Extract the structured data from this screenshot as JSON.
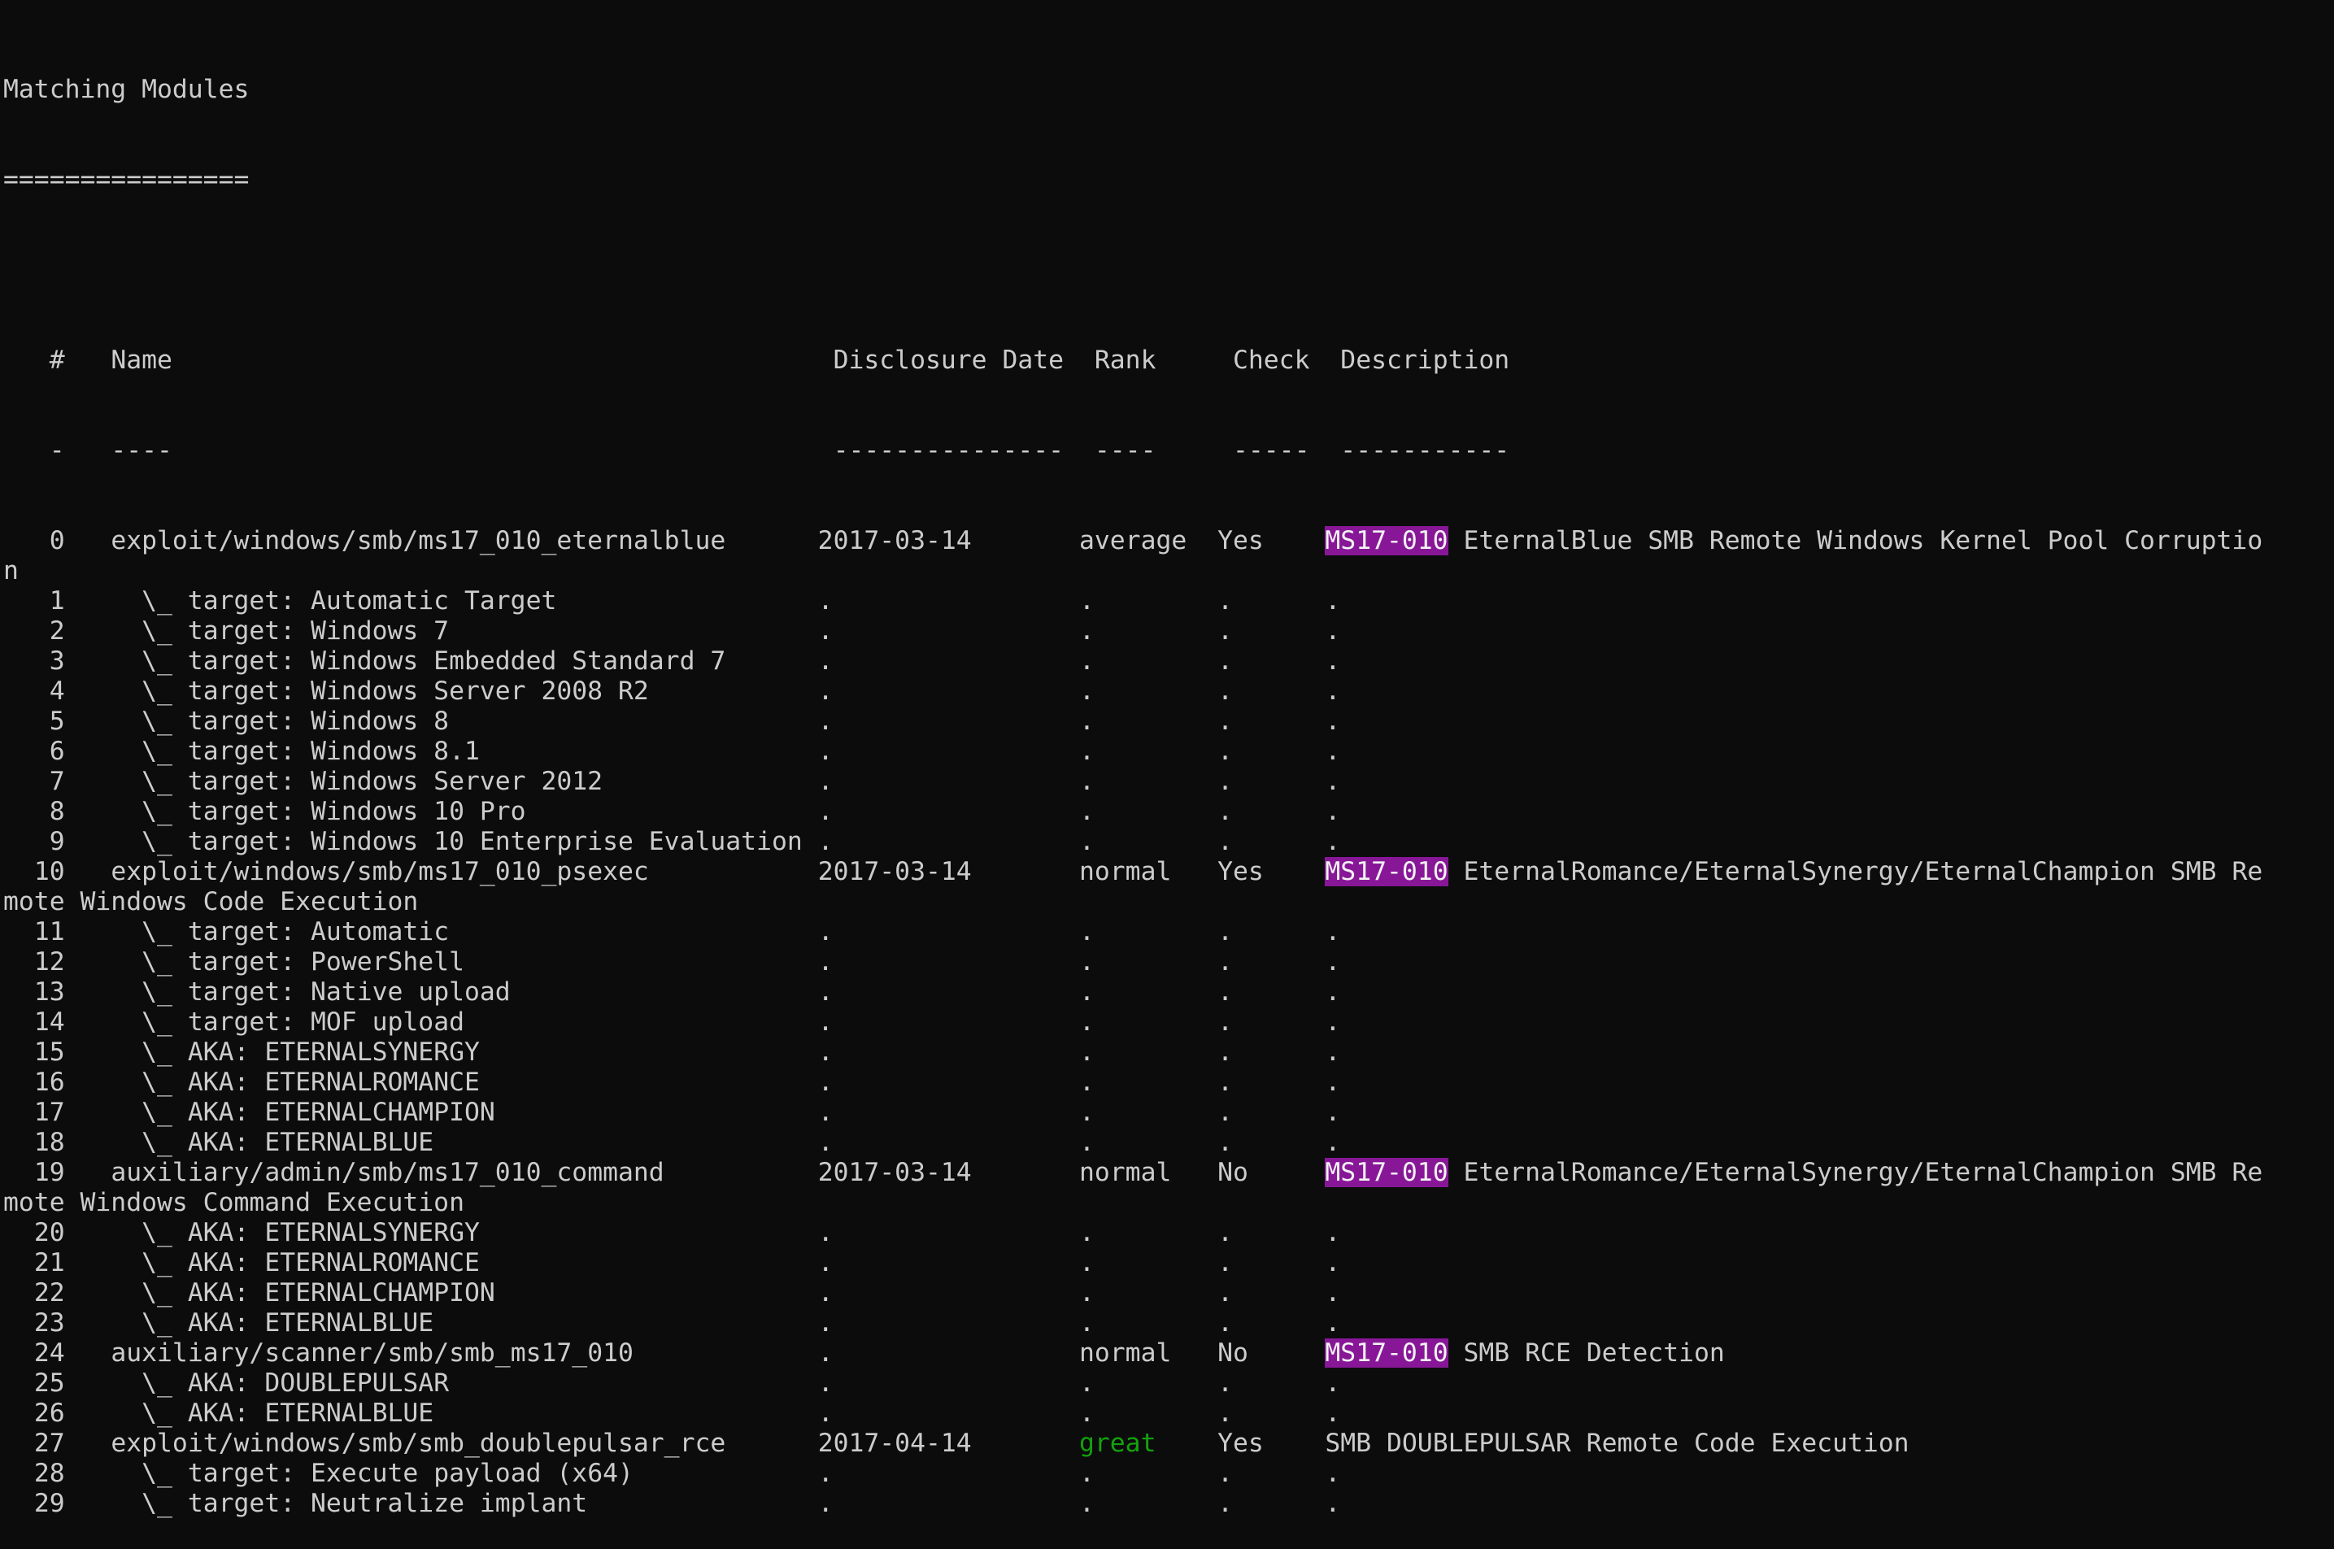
{
  "terminal": {
    "title": "Matching Modules",
    "title_underline": "================",
    "headers": {
      "num": "#",
      "name": "Name",
      "date": "Disclosure Date",
      "rank": "Rank",
      "check": "Check",
      "desc": "Description"
    },
    "header_underlines": {
      "num": "-",
      "name": "----",
      "date": "---------------",
      "rank": "----",
      "check": "-----",
      "desc": "-----------"
    },
    "rows": [
      {
        "num": "0",
        "name": "exploit/windows/smb/ms17_010_eternalblue",
        "date": "2017-03-14",
        "rank": "average",
        "check": "Yes",
        "desc_highlight": "MS17-010",
        "desc": " EternalBlue SMB Remote Windows Kernel Pool Corruptio",
        "wrap": "n"
      },
      {
        "num": "1",
        "name": "  \\_ target: Automatic Target",
        "date": ".",
        "rank": ".",
        "check": ".",
        "desc": "."
      },
      {
        "num": "2",
        "name": "  \\_ target: Windows 7",
        "date": ".",
        "rank": ".",
        "check": ".",
        "desc": "."
      },
      {
        "num": "3",
        "name": "  \\_ target: Windows Embedded Standard 7",
        "date": ".",
        "rank": ".",
        "check": ".",
        "desc": "."
      },
      {
        "num": "4",
        "name": "  \\_ target: Windows Server 2008 R2",
        "date": ".",
        "rank": ".",
        "check": ".",
        "desc": "."
      },
      {
        "num": "5",
        "name": "  \\_ target: Windows 8",
        "date": ".",
        "rank": ".",
        "check": ".",
        "desc": "."
      },
      {
        "num": "6",
        "name": "  \\_ target: Windows 8.1",
        "date": ".",
        "rank": ".",
        "check": ".",
        "desc": "."
      },
      {
        "num": "7",
        "name": "  \\_ target: Windows Server 2012",
        "date": ".",
        "rank": ".",
        "check": ".",
        "desc": "."
      },
      {
        "num": "8",
        "name": "  \\_ target: Windows 10 Pro",
        "date": ".",
        "rank": ".",
        "check": ".",
        "desc": "."
      },
      {
        "num": "9",
        "name": "  \\_ target: Windows 10 Enterprise Evaluation",
        "date": ".",
        "rank": ".",
        "check": ".",
        "desc": "."
      },
      {
        "num": "10",
        "name": "exploit/windows/smb/ms17_010_psexec",
        "date": "2017-03-14",
        "rank": "normal",
        "check": "Yes",
        "desc_highlight": "MS17-010",
        "desc": " EternalRomance/EternalSynergy/EternalChampion SMB Re",
        "wrap": "mote Windows Code Execution"
      },
      {
        "num": "11",
        "name": "  \\_ target: Automatic",
        "date": ".",
        "rank": ".",
        "check": ".",
        "desc": "."
      },
      {
        "num": "12",
        "name": "  \\_ target: PowerShell",
        "date": ".",
        "rank": ".",
        "check": ".",
        "desc": "."
      },
      {
        "num": "13",
        "name": "  \\_ target: Native upload",
        "date": ".",
        "rank": ".",
        "check": ".",
        "desc": "."
      },
      {
        "num": "14",
        "name": "  \\_ target: MOF upload",
        "date": ".",
        "rank": ".",
        "check": ".",
        "desc": "."
      },
      {
        "num": "15",
        "name": "  \\_ AKA: ETERNALSYNERGY",
        "date": ".",
        "rank": ".",
        "check": ".",
        "desc": "."
      },
      {
        "num": "16",
        "name": "  \\_ AKA: ETERNALROMANCE",
        "date": ".",
        "rank": ".",
        "check": ".",
        "desc": "."
      },
      {
        "num": "17",
        "name": "  \\_ AKA: ETERNALCHAMPION",
        "date": ".",
        "rank": ".",
        "check": ".",
        "desc": "."
      },
      {
        "num": "18",
        "name": "  \\_ AKA: ETERNALBLUE",
        "date": ".",
        "rank": ".",
        "check": ".",
        "desc": "."
      },
      {
        "num": "19",
        "name": "auxiliary/admin/smb/ms17_010_command",
        "date": "2017-03-14",
        "rank": "normal",
        "check": "No",
        "desc_highlight": "MS17-010",
        "desc": " EternalRomance/EternalSynergy/EternalChampion SMB Re",
        "wrap": "mote Windows Command Execution"
      },
      {
        "num": "20",
        "name": "  \\_ AKA: ETERNALSYNERGY",
        "date": ".",
        "rank": ".",
        "check": ".",
        "desc": "."
      },
      {
        "num": "21",
        "name": "  \\_ AKA: ETERNALROMANCE",
        "date": ".",
        "rank": ".",
        "check": ".",
        "desc": "."
      },
      {
        "num": "22",
        "name": "  \\_ AKA: ETERNALCHAMPION",
        "date": ".",
        "rank": ".",
        "check": ".",
        "desc": "."
      },
      {
        "num": "23",
        "name": "  \\_ AKA: ETERNALBLUE",
        "date": ".",
        "rank": ".",
        "check": ".",
        "desc": "."
      },
      {
        "num": "24",
        "name": "auxiliary/scanner/smb/smb_ms17_010",
        "date": ".",
        "rank": "normal",
        "check": "No",
        "desc_highlight": "MS17-010",
        "desc": " SMB RCE Detection"
      },
      {
        "num": "25",
        "name": "  \\_ AKA: DOUBLEPULSAR",
        "date": ".",
        "rank": ".",
        "check": ".",
        "desc": "."
      },
      {
        "num": "26",
        "name": "  \\_ AKA: ETERNALBLUE",
        "date": ".",
        "rank": ".",
        "check": ".",
        "desc": "."
      },
      {
        "num": "27",
        "name": "exploit/windows/smb/smb_doublepulsar_rce",
        "date": "2017-04-14",
        "rank": "great",
        "rank_color": "#13a10e",
        "check": "Yes",
        "desc": "SMB DOUBLEPULSAR Remote Code Execution"
      },
      {
        "num": "28",
        "name": "  \\_ target: Execute payload (x64)",
        "date": ".",
        "rank": ".",
        "check": ".",
        "desc": "."
      },
      {
        "num": "29",
        "name": "  \\_ target: Neutralize implant",
        "date": ".",
        "rank": ".",
        "check": ".",
        "desc": "."
      }
    ],
    "colors": {
      "background": "#0c0c0c",
      "foreground": "#cccccc",
      "highlight_bg": "#881798",
      "great": "#13a10e"
    }
  }
}
